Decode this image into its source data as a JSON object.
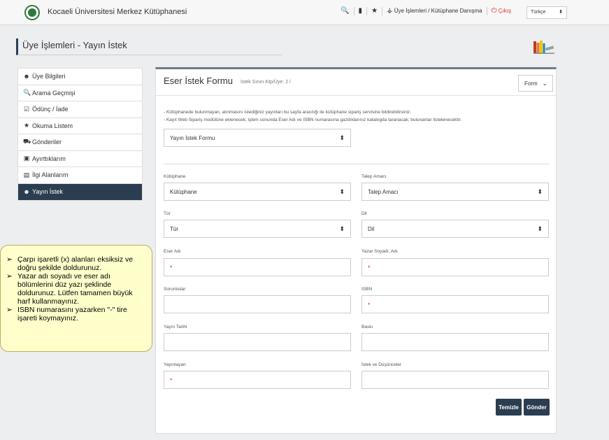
{
  "header": {
    "site_title": "Kocaeli Üniversitesi Merkez Kütüphanesi",
    "member_ops": "Üye İşlemleri / Kütüphane Danışma",
    "logout": "Çıkış",
    "language": "Türkçe"
  },
  "page": {
    "title": "Üye İşlemleri - Yayın İstek"
  },
  "sidebar": {
    "items": [
      {
        "label": "Üye Bilgileri",
        "icon": "user-icon"
      },
      {
        "label": "Arama Geçmişi",
        "icon": "search-icon"
      },
      {
        "label": "Ödünç / İade",
        "icon": "calendar-check-icon"
      },
      {
        "label": "Okuma Listem",
        "icon": "star-icon"
      },
      {
        "label": "Gönderiler",
        "icon": "truck-icon"
      },
      {
        "label": "Ayırttıklarım",
        "icon": "inbox-icon"
      },
      {
        "label": "İlgi Alanlarım",
        "icon": "list-icon"
      },
      {
        "label": "Yayın İstek",
        "icon": "user-icon"
      }
    ]
  },
  "note": {
    "items": [
      "Çarpı işaretli (x) alanları eksiksiz ve doğru şekilde doldurunuz.",
      "Yazar adı soyadı ve eser adı bölümlerini düz yazı şeklinde doldurunuz. Lütfen tamamen büyük harf kullanmayınız.",
      " ISBN numarasını yazarken \"-\" tire işareti koymayınız."
    ]
  },
  "form": {
    "title": "Eser İstek Formu",
    "limit": "İstek Sınırı Ktp/Üye: 2 /",
    "mode": "Form",
    "info1": "- Kütüphanede bulunmayan, alınmasını istediğiniz yayınları bu sayfa aracılığı ile kütüphane sipariş servisine bildirebilirsiniz.",
    "info2": "- Kayıt Web Sipariş modülüne eklenecek; işlem sonunda Eser Adı ve ISBN numarasına gazdıklarınız katalogda taranacak; bulunanlar listelenecektir.",
    "form_type": "Yayın İstek Formu",
    "library_label": "Kütüphane",
    "library_value": "Kütüphane",
    "purpose_label": "Talep Amacı",
    "purpose_value": "Talep Amacı",
    "type_label": "Tür",
    "type_value": "Tür",
    "language_label": "Dil",
    "language_value": "Dil",
    "title_label": "Eser Adı",
    "author_label": "Yazar Soyadı, Adı",
    "responsible_label": "Sorumlular",
    "isbn_label": "ISBN",
    "pubdate_label": "Yayın Tarihi",
    "edition_label": "Baskı",
    "publisher_label": "Yayınlayan",
    "comments_label": "İstek ve Düşünceler",
    "required_mark": "*",
    "clear_button": "Temizle",
    "submit_button": "Gönder"
  }
}
